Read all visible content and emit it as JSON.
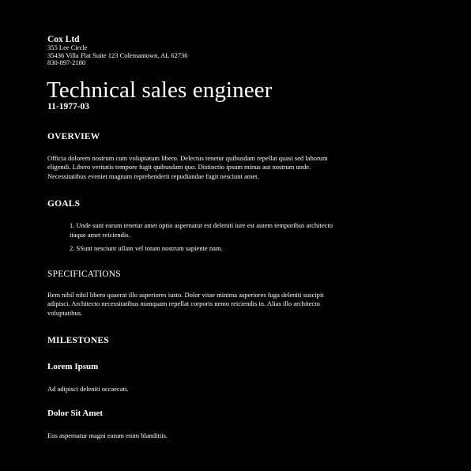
{
  "company": {
    "name": "Cox Ltd",
    "address_line1": "355 Lee Circle",
    "address_line2": "35436 Villa Flat Suite 123 Colemantown, AL 62736",
    "phone": "830-897-2180"
  },
  "document": {
    "title": "Technical sales engineer",
    "number": "11-1977-03"
  },
  "overview": {
    "heading": "OVERVIEW",
    "body": "Officia dolorem nostrum cum voluptatum libero. Delectus tenetur quibusdam repellat quasi sed laborum eligendi. Libero veritatis tempore fugit quibusdam quo. Distinctio ipsum minus aut nostrum unde. Necessitatibus eveniet magnam reprehenderit repudiandae fugit nesciunt amet."
  },
  "goals": {
    "heading": "GOALS",
    "items": [
      "1. Unde sunt earum tenetur amet optio aspernatur est deleniti iure est autem temporibus architecto itaque amet reiciendis.",
      "2. SSunt nesciunt ullam vel totam nostrum sapiente nam."
    ]
  },
  "specifications": {
    "heading": "SPECIFICATIONS",
    "body": "Rem nihil nihil libero quaerat illo asperiores iusto. Dolor vitae minima asperiores fuga deleniti suscipit adipisci. Architecto necessitatibus numquam repellat corporis nemo reiciendis in. Alias illo architecto voluptatibus."
  },
  "milestones": {
    "heading": "MILESTONES",
    "items": [
      {
        "title": "Lorem Ipsum",
        "body": "Ad adipisci deleniti occaecati."
      },
      {
        "title": "Dolor Sit Amet",
        "body": "Eos aspernatur magni earum enim blanditiis."
      }
    ]
  }
}
